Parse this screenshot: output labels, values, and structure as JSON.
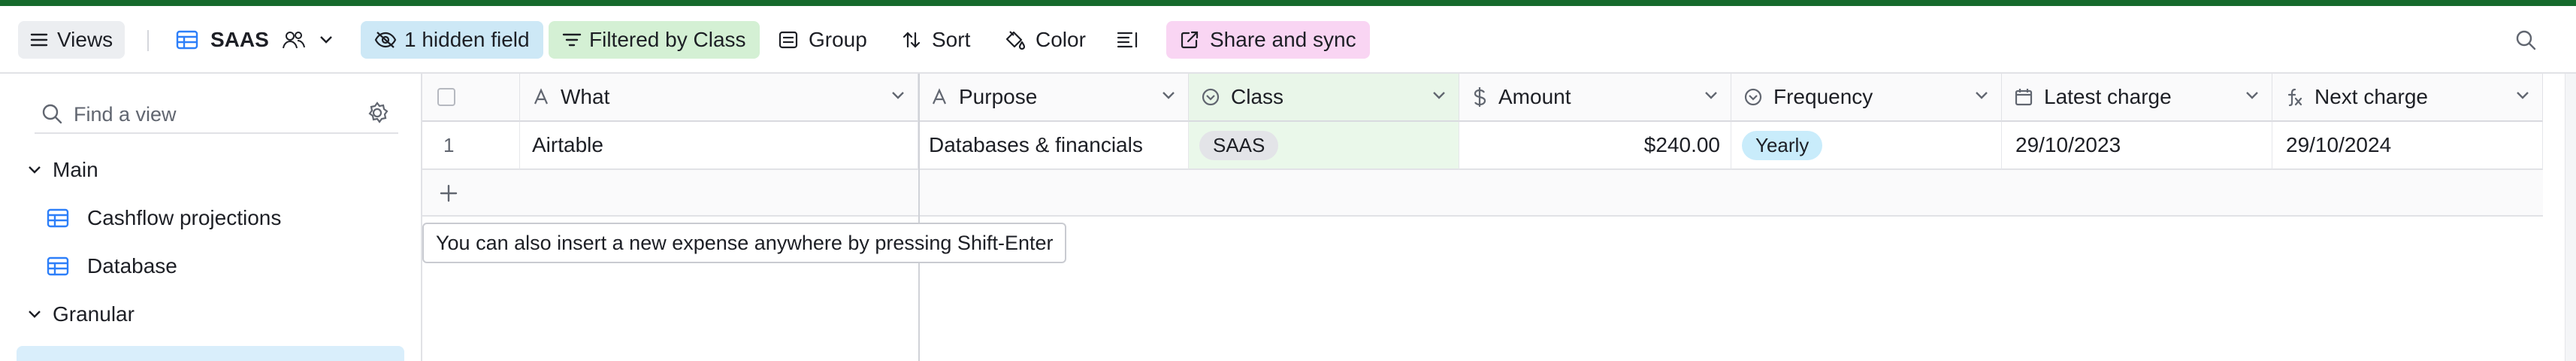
{
  "toolbar": {
    "views_label": "Views",
    "table_name": "SAAS",
    "hidden_label": "1 hidden field",
    "filter_label": "Filtered by Class",
    "group_label": "Group",
    "sort_label": "Sort",
    "color_label": "Color",
    "share_label": "Share and sync"
  },
  "sidebar": {
    "search_placeholder": "Find a view",
    "sections": [
      {
        "label": "Main",
        "items": [
          {
            "label": "Cashflow projections"
          },
          {
            "label": "Database"
          }
        ]
      },
      {
        "label": "Granular"
      }
    ]
  },
  "grid": {
    "columns": [
      {
        "label": "What",
        "icon": "text-a-icon"
      },
      {
        "label": "Purpose",
        "icon": "text-a-icon"
      },
      {
        "label": "Class",
        "icon": "single-select-icon"
      },
      {
        "label": "Amount",
        "icon": "currency-icon"
      },
      {
        "label": "Frequency",
        "icon": "single-select-icon"
      },
      {
        "label": "Latest charge",
        "icon": "calendar-icon"
      },
      {
        "label": "Next charge",
        "icon": "formula-icon"
      }
    ],
    "rows": [
      {
        "num": "1",
        "what": "Airtable",
        "purpose": "Databases & financials",
        "class": "SAAS",
        "amount": "$240.00",
        "frequency": "Yearly",
        "latest": "29/10/2023",
        "next": "29/10/2024"
      }
    ],
    "tooltip": "You can also insert a new expense anywhere by pressing Shift-Enter"
  },
  "colors": {
    "accent_green": "#166a2c",
    "hidden_bg": "#cde8f6",
    "filter_bg": "#d4f0d4",
    "share_bg": "#f9d5f3",
    "class_chip_bg": "#e9eaed",
    "frequency_chip_bg": "#c9ecfb",
    "filtered_col_bg": "#eaf8ea"
  }
}
